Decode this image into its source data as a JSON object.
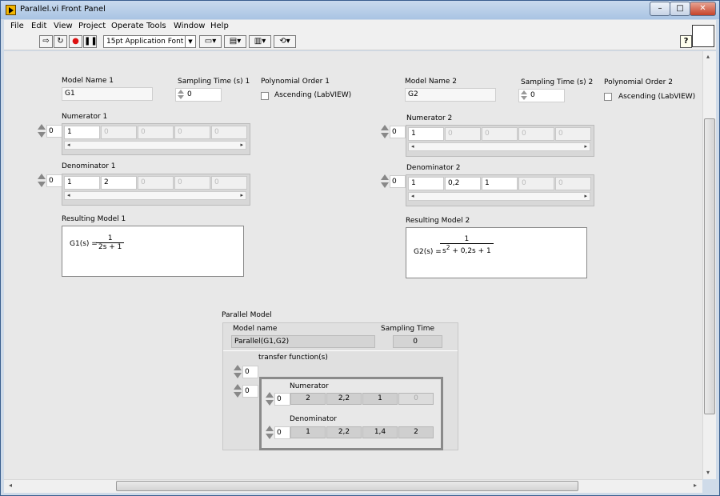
{
  "window": {
    "title": "Parallel.vi Front Panel"
  },
  "menu": [
    "File",
    "Edit",
    "View",
    "Project",
    "Operate",
    "Tools",
    "Window",
    "Help"
  ],
  "toolbar": {
    "font": "15pt Application Font",
    "help": "?"
  },
  "model1": {
    "name_label": "Model Name 1",
    "name_value": "G1",
    "ts_label": "Sampling Time (s) 1",
    "ts_value": "0",
    "poly_label": "Polynomial Order 1",
    "asc_label": "Ascending (LabVIEW)",
    "num_label": "Numerator 1",
    "num_index": "0",
    "num_values": [
      "1",
      "0",
      "0",
      "0",
      "0"
    ],
    "den_label": "Denominator 1",
    "den_index": "0",
    "den_values": [
      "1",
      "2",
      "0",
      "0",
      "0"
    ],
    "res_label": "Resulting Model 1",
    "res_lhs": "G1(s) =",
    "res_num": "1",
    "res_den": "2s + 1"
  },
  "model2": {
    "name_label": "Model Name 2",
    "name_value": "G2",
    "ts_label": "Sampling Time (s) 2",
    "ts_value": "0",
    "poly_label": "Polynomial Order 2",
    "asc_label": "Ascending (LabVIEW)",
    "num_label": "Numerator 2",
    "num_index": "0",
    "num_values": [
      "1",
      "0",
      "0",
      "0",
      "0"
    ],
    "den_label": "Denominator 2",
    "den_index": "0",
    "den_values": [
      "1",
      "0,2",
      "1",
      "0",
      "0"
    ],
    "res_label": "Resulting Model 2",
    "res_lhs": "G2(s) =",
    "res_num": "1",
    "res_den_a": "s",
    "res_den_exp": "2",
    "res_den_b": " + 0,2s + 1"
  },
  "parallel": {
    "label": "Parallel Model",
    "model_name_label": "Model name",
    "model_name_value": "Parallel(G1,G2)",
    "ts_label": "Sampling Time",
    "ts_value": "0",
    "tf_label": "transfer function(s)",
    "tf_index1": "0",
    "tf_index2": "0",
    "num_label": "Numerator",
    "num_index": "0",
    "num_values": [
      "2",
      "2,2",
      "1",
      "0"
    ],
    "den_label": "Denominator",
    "den_index": "0",
    "den_values": [
      "1",
      "2,2",
      "1,4",
      "2"
    ]
  }
}
